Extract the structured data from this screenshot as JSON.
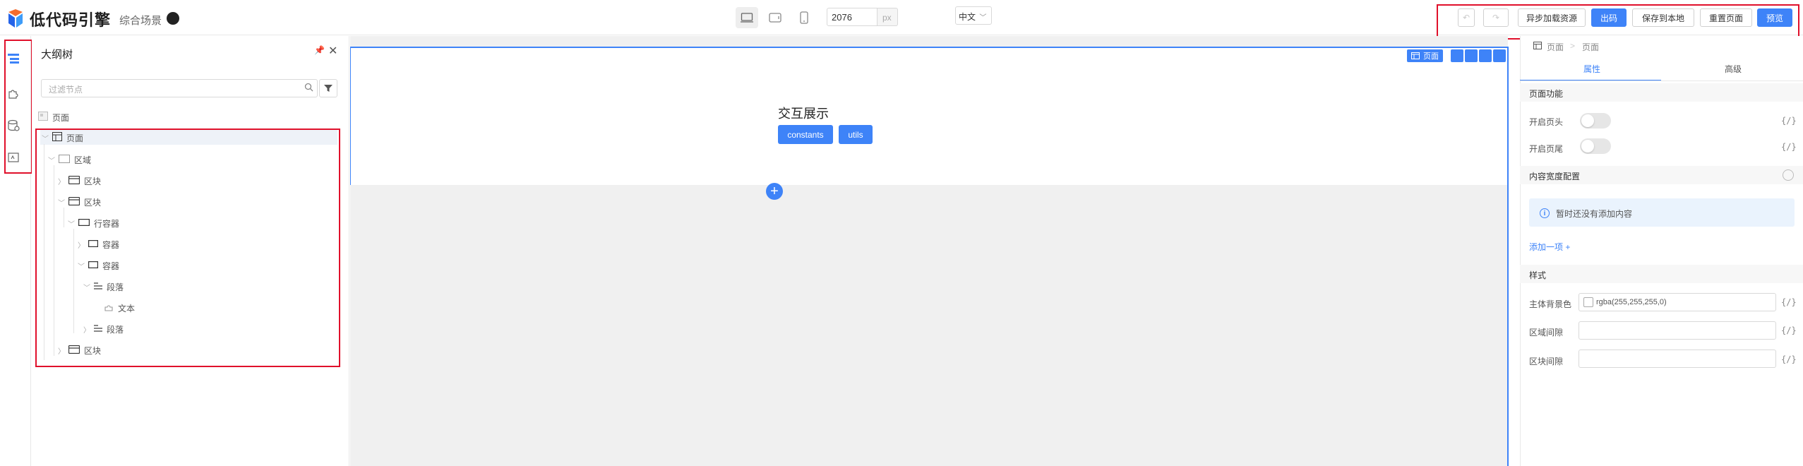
{
  "app": {
    "logo_text": "低代码引擎",
    "scene_label": "综合场景"
  },
  "toolbar": {
    "width_value": "2076",
    "width_unit": "px",
    "language": "中文",
    "async_load": "异步加载资源",
    "export_code": "出码",
    "save_local": "保存到本地",
    "reset_page": "重置页面",
    "preview": "预览"
  },
  "outline": {
    "title": "大纲树",
    "filter_placeholder": "过滤节点",
    "rows": [
      {
        "label": "页面",
        "type": "root"
      },
      {
        "label": "页面"
      },
      {
        "label": "区域"
      },
      {
        "label": "区块"
      },
      {
        "label": "区块"
      },
      {
        "label": "行容器"
      },
      {
        "label": "容器"
      },
      {
        "label": "容器"
      },
      {
        "label": "段落"
      },
      {
        "label": "文本"
      },
      {
        "label": "段落"
      },
      {
        "label": "区块"
      }
    ]
  },
  "canvas": {
    "page_tag": "页面",
    "demo_title": "交互展示",
    "buttons": [
      "constants",
      "utils"
    ]
  },
  "settings": {
    "breadcrumb": [
      "页面",
      "页面"
    ],
    "tabs": [
      "属性",
      "高级"
    ],
    "page_feature_section": "页面功能",
    "show_header_label": "开启页头",
    "show_footer_label": "开启页尾",
    "content_width_section": "内容宽度配置",
    "empty_notice": "暂时还没有添加内容",
    "add_item": "添加一项 +",
    "style_section": "样式",
    "bg_color_label": "主体背景色",
    "bg_color_value": "rgba(255,255,255,0)",
    "area_gap_label": "区域间隙",
    "block_gap_label": "区块间隙",
    "fx_text": "{/}"
  },
  "colors": {
    "primary": "#3e83f8",
    "highlight_frame": "#e0102b"
  }
}
